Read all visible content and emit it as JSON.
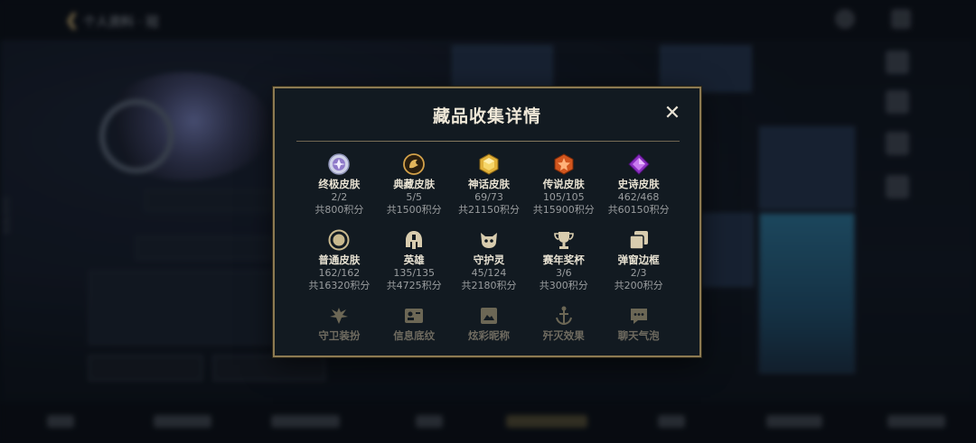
{
  "background": {
    "top_title": "个人资料 · 冠",
    "vertical_id": "21327878"
  },
  "modal": {
    "title": "藏品收集详情",
    "close_label": "✕",
    "items": [
      {
        "name": "终极皮肤",
        "count": "2/2",
        "points": "共800积分",
        "icon": "ultimate-skin-icon"
      },
      {
        "name": "典藏皮肤",
        "count": "5/5",
        "points": "共1500积分",
        "icon": "prestige-skin-icon"
      },
      {
        "name": "神话皮肤",
        "count": "69/73",
        "points": "共21150积分",
        "icon": "mythic-skin-icon"
      },
      {
        "name": "传说皮肤",
        "count": "105/105",
        "points": "共15900积分",
        "icon": "legendary-skin-icon"
      },
      {
        "name": "史诗皮肤",
        "count": "462/468",
        "points": "共60150积分",
        "icon": "epic-skin-icon"
      },
      {
        "name": "普通皮肤",
        "count": "162/162",
        "points": "共16320积分",
        "icon": "standard-skin-icon"
      },
      {
        "name": "英雄",
        "count": "135/135",
        "points": "共4725积分",
        "icon": "champion-helmet-icon"
      },
      {
        "name": "守护灵",
        "count": "45/124",
        "points": "共2180积分",
        "icon": "guardian-spirit-icon"
      },
      {
        "name": "赛年奖杯",
        "count": "3/6",
        "points": "共300积分",
        "icon": "trophy-icon"
      },
      {
        "name": "弹窗边框",
        "count": "2/3",
        "points": "共200积分",
        "icon": "popup-frame-icon"
      }
    ],
    "locked_items": [
      {
        "name": "守卫装扮",
        "icon": "ward-skin-icon"
      },
      {
        "name": "信息底纹",
        "icon": "profile-banner-icon"
      },
      {
        "name": "炫彩昵称",
        "icon": "nameplate-icon"
      },
      {
        "name": "歼灭效果",
        "icon": "elimination-effect-icon"
      },
      {
        "name": "聊天气泡",
        "icon": "chat-bubble-icon"
      }
    ]
  }
}
